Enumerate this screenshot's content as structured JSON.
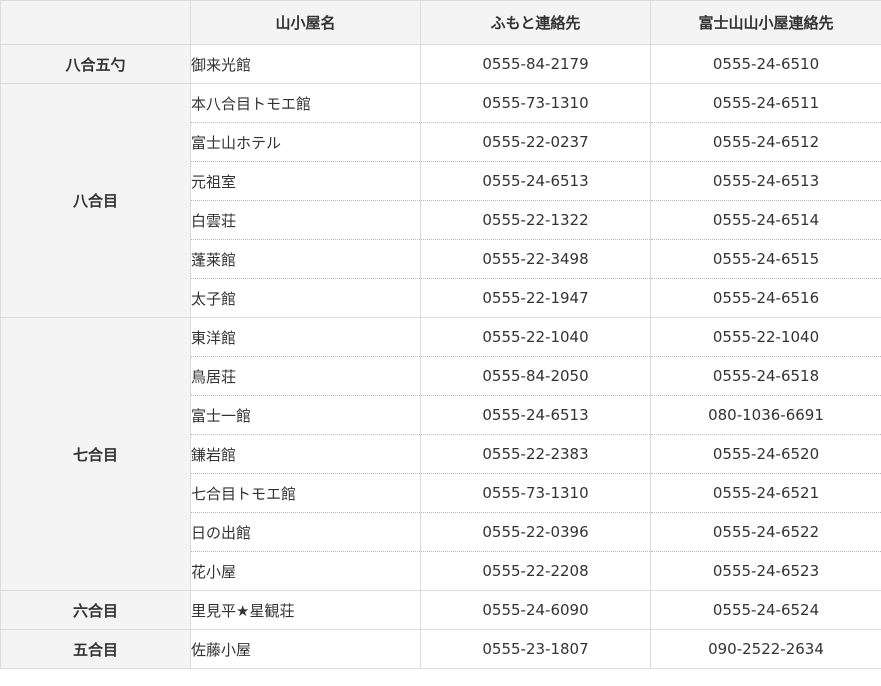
{
  "headers": {
    "station": "",
    "hut_name": "山小屋名",
    "base_contact": "ふもと連絡先",
    "mountain_contact": "富士山山小屋連絡先"
  },
  "groups": [
    {
      "station": "八合五勺",
      "huts": [
        {
          "name": "御来光館",
          "base": "0555-84-2179",
          "mountain": "0555-24-6510"
        }
      ]
    },
    {
      "station": "八合目",
      "huts": [
        {
          "name": "本八合目トモエ館",
          "base": "0555-73-1310",
          "mountain": "0555-24-6511"
        },
        {
          "name": "富士山ホテル",
          "base": "0555-22-0237",
          "mountain": "0555-24-6512"
        },
        {
          "name": "元祖室",
          "base": "0555-24-6513",
          "mountain": "0555-24-6513"
        },
        {
          "name": "白雲荘",
          "base": "0555-22-1322",
          "mountain": "0555-24-6514"
        },
        {
          "name": "蓬莱館",
          "base": "0555-22-3498",
          "mountain": "0555-24-6515"
        },
        {
          "name": "太子館",
          "base": "0555-22-1947",
          "mountain": "0555-24-6516"
        }
      ]
    },
    {
      "station": "七合目",
      "huts": [
        {
          "name": "東洋館",
          "base": "0555-22-1040",
          "mountain": "0555-22-1040"
        },
        {
          "name": "鳥居荘",
          "base": "0555-84-2050",
          "mountain": "0555-24-6518"
        },
        {
          "name": "富士一館",
          "base": "0555-24-6513",
          "mountain": "080-1036-6691"
        },
        {
          "name": "鎌岩館",
          "base": "0555-22-2383",
          "mountain": "0555-24-6520"
        },
        {
          "name": "七合目トモエ館",
          "base": "0555-73-1310",
          "mountain": "0555-24-6521"
        },
        {
          "name": "日の出館",
          "base": "0555-22-0396",
          "mountain": "0555-24-6522"
        },
        {
          "name": "花小屋",
          "base": "0555-22-2208",
          "mountain": "0555-24-6523"
        }
      ]
    },
    {
      "station": "六合目",
      "huts": [
        {
          "name": "里見平★星観荘",
          "base": "0555-24-6090",
          "mountain": "0555-24-6524"
        }
      ]
    },
    {
      "station": "五合目",
      "huts": [
        {
          "name": "佐藤小屋",
          "base": "0555-23-1807",
          "mountain": "090-2522-2634"
        }
      ]
    }
  ]
}
